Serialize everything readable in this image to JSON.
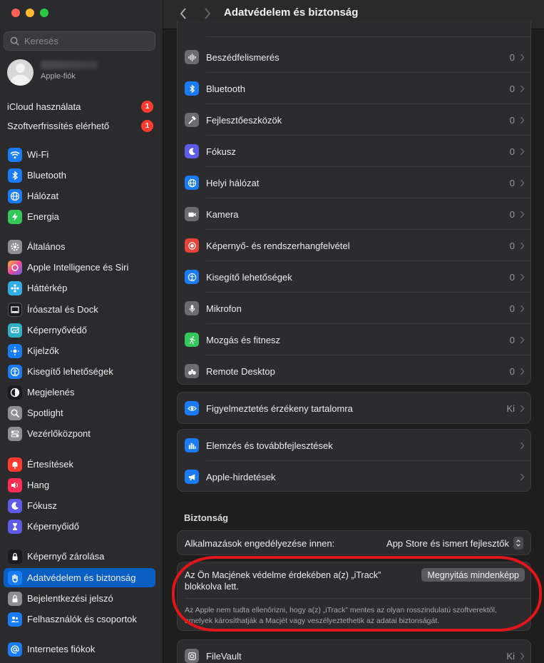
{
  "window": {
    "title": "Adatvédelem és biztonság"
  },
  "search": {
    "placeholder": "Keresés"
  },
  "account": {
    "subtitle": "Apple-fiók"
  },
  "notices": [
    {
      "label": "iCloud használata",
      "badge": "1"
    },
    {
      "label": "Szoftverfrissítés elérhető",
      "badge": "1"
    }
  ],
  "sidebar": {
    "items": [
      {
        "label": "Wi-Fi"
      },
      {
        "label": "Bluetooth"
      },
      {
        "label": "Hálózat"
      },
      {
        "label": "Energia"
      },
      {
        "label": "Általános"
      },
      {
        "label": "Apple Intelligence és Siri"
      },
      {
        "label": "Háttérkép"
      },
      {
        "label": "Íróasztal és Dock"
      },
      {
        "label": "Képernyővédő"
      },
      {
        "label": "Kijelzők"
      },
      {
        "label": "Kisegítő lehetőségek"
      },
      {
        "label": "Megjelenés"
      },
      {
        "label": "Spotlight"
      },
      {
        "label": "Vezérlőközpont"
      },
      {
        "label": "Értesítések"
      },
      {
        "label": "Hang"
      },
      {
        "label": "Fókusz"
      },
      {
        "label": "Képernyőidő"
      },
      {
        "label": "Képernyő zárolása"
      },
      {
        "label": "Adatvédelem és biztonság"
      },
      {
        "label": "Bejelentkezési jelszó"
      },
      {
        "label": "Felhasználók és csoportok"
      },
      {
        "label": "Internetes fiókok"
      }
    ],
    "selected": "Adatvédelem és biztonság"
  },
  "privacy_rows": [
    {
      "label": "Beszédfelismerés",
      "value": "0",
      "icon": "waveform-icon",
      "color": "#6b6b70"
    },
    {
      "label": "Bluetooth",
      "value": "0",
      "icon": "bluetooth-icon",
      "color": "#1a7cf5"
    },
    {
      "label": "Fejlesztőeszközök",
      "value": "0",
      "icon": "hammer-icon",
      "color": "#6b6b70"
    },
    {
      "label": "Fókusz",
      "value": "0",
      "icon": "moon-icon",
      "color": "#5e5ce6"
    },
    {
      "label": "Helyi hálózat",
      "value": "0",
      "icon": "globe-icon",
      "color": "#1a7cf5"
    },
    {
      "label": "Kamera",
      "value": "0",
      "icon": "camera-icon",
      "color": "#6b6b70"
    },
    {
      "label": "Képernyő- és rendszerhangfelvétel",
      "value": "0",
      "icon": "record-icon",
      "color": "#e8433a"
    },
    {
      "label": "Kisegítő lehetőségek",
      "value": "0",
      "icon": "accessibility-icon",
      "color": "#1a7cf5"
    },
    {
      "label": "Mikrofon",
      "value": "0",
      "icon": "microphone-icon",
      "color": "#6b6b70"
    },
    {
      "label": "Mozgás és fitnesz",
      "value": "0",
      "icon": "running-icon",
      "color": "#34c759"
    },
    {
      "label": "Remote Desktop",
      "value": "0",
      "icon": "binoculars-icon",
      "color": "#6b6b70"
    }
  ],
  "sensitive": {
    "label": "Figyelmeztetés érzékeny tartalomra",
    "value": "Ki"
  },
  "analytics": [
    {
      "label": "Elemzés és továbbfejlesztések"
    },
    {
      "label": "Apple-hirdetések"
    }
  ],
  "security": {
    "title": "Biztonság",
    "allow_label": "Alkalmazások engedélyezése innen:",
    "allow_value": "App Store és ismert fejlesztők",
    "warning": "Az Ön Macjének védelme érdekében a(z) „iTrack” blokkolva lett.",
    "open_button": "Megnyitás mindenképp",
    "detail": "Az Apple nem tudta ellenőrizni, hogy a(z) „iTrack” mentes az olyan rosszindulatú szoftverektől, amelyek károsíthatják a Macjét vagy veszélyeztethetik az adatai biztonságát.",
    "filevault_label": "FileVault",
    "filevault_value": "Ki"
  },
  "colors": {
    "accent": "#0a5fc4",
    "highlight": "#e0161b"
  }
}
